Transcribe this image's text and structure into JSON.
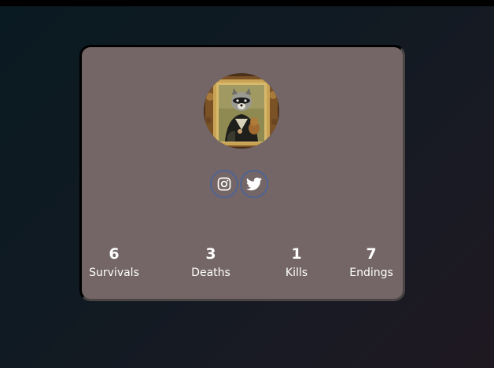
{
  "profile": {
    "avatar_icon": "raccoon-portrait-avatar"
  },
  "socials": [
    {
      "icon": "instagram-icon",
      "color": "#4e6396"
    },
    {
      "icon": "twitter-icon",
      "color": "#4e6396"
    }
  ],
  "stats": [
    {
      "value": "6",
      "label": "Survivals"
    },
    {
      "value": "3",
      "label": "Deaths"
    },
    {
      "value": "1",
      "label": "Kills"
    },
    {
      "value": "7",
      "label": "Endings"
    }
  ],
  "colors": {
    "card_background": "#746666",
    "page_background": "#0f1a22",
    "text": "#ffffff"
  }
}
